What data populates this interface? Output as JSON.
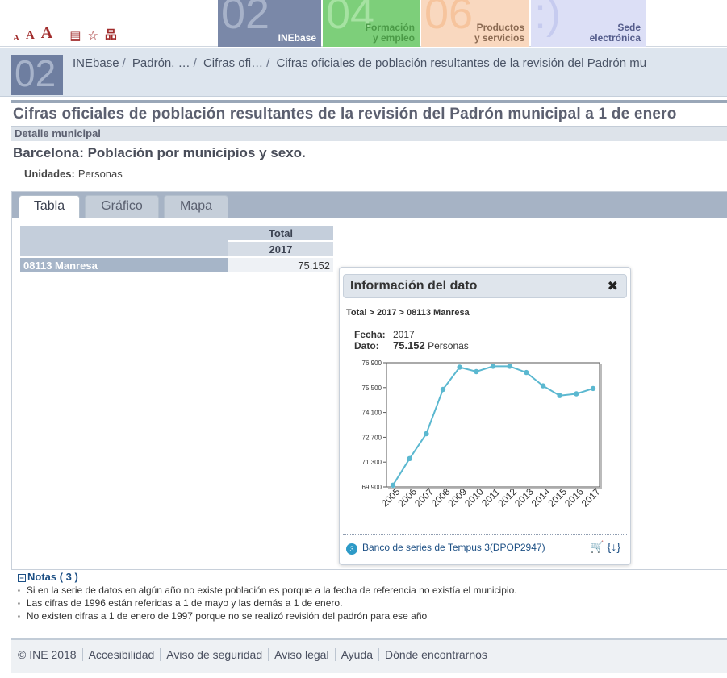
{
  "header": {
    "font_sizes": [
      "A",
      "A",
      "A"
    ],
    "tool_icons": [
      "print-icon",
      "favorite-icon",
      "sitemap-icon"
    ],
    "tiles": [
      {
        "number": "02",
        "label": "INEbase",
        "color": "#7a88a8"
      },
      {
        "number": "04",
        "label_line1": "Formación",
        "label_line2": "y empleo",
        "color": "#7dcf7a"
      },
      {
        "number": "06",
        "label_line1": "Productos",
        "label_line2": "y servicios",
        "color": "#f9d8bf"
      },
      {
        "number": ":)",
        "label_line1": "Sede",
        "label_line2": "electrónica",
        "color": "#dcdff6"
      }
    ]
  },
  "breadcrumb": {
    "badge": "02",
    "items": [
      "INEbase",
      "Padrón. …",
      "Cifras ofi…",
      "Cifras oficiales de población resultantes de la revisión del Padrón mu"
    ]
  },
  "page": {
    "title": "Cifras oficiales de población resultantes de la revisión del Padrón municipal a 1 de enero",
    "subtitle": "Detalle municipal",
    "table_title": "Barcelona: Población por municipios y sexo.",
    "units_label": "Unidades:",
    "units_value": "Personas"
  },
  "tabs": [
    {
      "label": "Tabla",
      "active": true
    },
    {
      "label": "Gráfico",
      "active": false
    },
    {
      "label": "Mapa",
      "active": false
    }
  ],
  "table": {
    "column_header": "Total",
    "year": "2017",
    "rows": [
      {
        "label": "08113 Manresa",
        "value": "75.152"
      }
    ]
  },
  "popup": {
    "title": "Información del dato",
    "path": "Total > 2017 > 08113 Manresa",
    "fecha_label": "Fecha:",
    "fecha_value": "2017",
    "dato_label": "Dato:",
    "dato_value": "75.152",
    "dato_unit": "Personas",
    "footer_link": "Banco de series de Tempus 3(DPOP2947)",
    "footer_icon_label": "3"
  },
  "chart_data": {
    "type": "line",
    "x": [
      "2005",
      "2006",
      "2007",
      "2008",
      "2009",
      "2010",
      "2011",
      "2012",
      "2013",
      "2014",
      "2015",
      "2016",
      "2017"
    ],
    "values": [
      70000,
      71500,
      72900,
      75400,
      76650,
      76400,
      76700,
      76700,
      76350,
      75600,
      75050,
      75150,
      75450
    ],
    "y_ticks": [
      "76.900",
      "75.500",
      "74.100",
      "72.700",
      "71.300",
      "69.900"
    ],
    "ylim": [
      69900,
      76900
    ],
    "line_color": "#5bb8d0",
    "grid": false
  },
  "notes": {
    "title": "Notas ( 3 )",
    "items": [
      "Si en la serie de datos en algún año no existe población es porque a la fecha de referencia no existía el municipio.",
      "Las cifras de 1996 están referidas a 1 de mayo y las demás a 1 de enero.",
      "No existen cifras a 1 de enero de 1997 porque no se realizó revisión del padrón para ese año"
    ]
  },
  "footer": {
    "links": [
      "© INE 2018",
      "Accesibilidad",
      "Aviso de seguridad",
      "Aviso legal",
      "Ayuda",
      "Dónde encontrarnos"
    ]
  }
}
